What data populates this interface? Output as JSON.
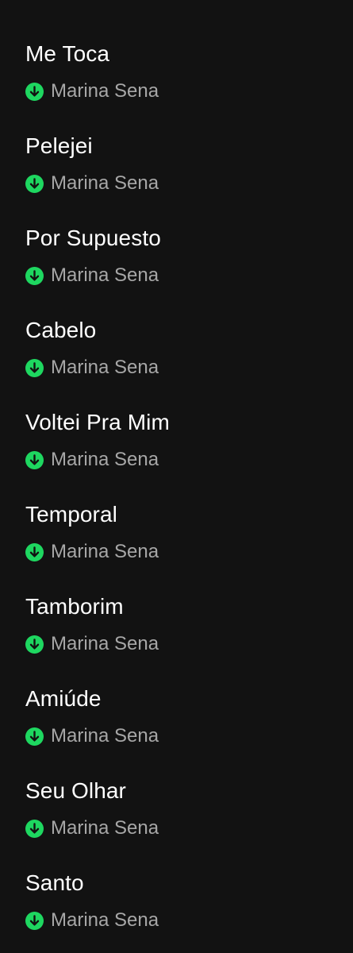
{
  "colors": {
    "background": "#121212",
    "title": "#ffffff",
    "artist": "#a7a7a7",
    "download_accent": "#1ed760"
  },
  "tracks": [
    {
      "title": "Me Toca",
      "artist": "Marina Sena",
      "downloaded_icon": "download-check-icon"
    },
    {
      "title": "Pelejei",
      "artist": "Marina Sena",
      "downloaded_icon": "download-check-icon"
    },
    {
      "title": "Por Supuesto",
      "artist": "Marina Sena",
      "downloaded_icon": "download-check-icon"
    },
    {
      "title": "Cabelo",
      "artist": "Marina Sena",
      "downloaded_icon": "download-check-icon"
    },
    {
      "title": "Voltei Pra Mim",
      "artist": "Marina Sena",
      "downloaded_icon": "download-check-icon"
    },
    {
      "title": "Temporal",
      "artist": "Marina Sena",
      "downloaded_icon": "download-check-icon"
    },
    {
      "title": "Tamborim",
      "artist": "Marina Sena",
      "downloaded_icon": "download-check-icon"
    },
    {
      "title": "Amiúde",
      "artist": "Marina Sena",
      "downloaded_icon": "download-check-icon"
    },
    {
      "title": "Seu Olhar",
      "artist": "Marina Sena",
      "downloaded_icon": "download-check-icon"
    },
    {
      "title": "Santo",
      "artist": "Marina Sena",
      "downloaded_icon": "download-check-icon"
    }
  ]
}
